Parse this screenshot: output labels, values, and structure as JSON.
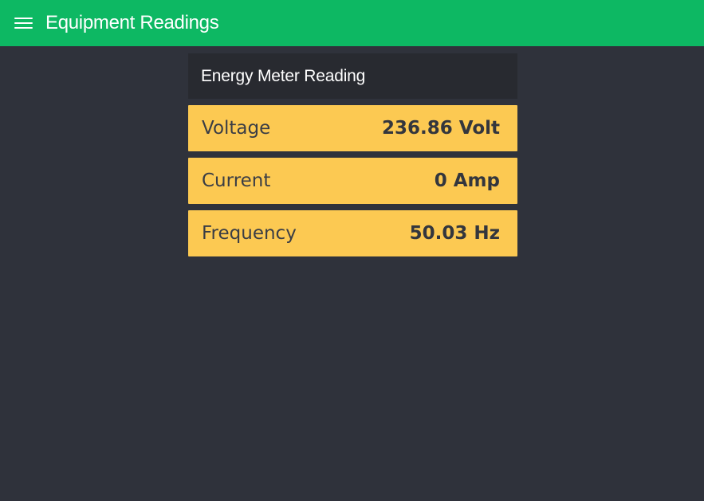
{
  "header": {
    "menu_icon": "hamburger-menu-icon",
    "title": "Equipment Readings"
  },
  "colors": {
    "header_bg": "#0db863",
    "page_bg": "#2f323b",
    "panel_header_bg": "#282a30",
    "reading_bg": "#fcc952"
  },
  "panel": {
    "title": "Energy Meter Reading",
    "readings": [
      {
        "label": "Voltage",
        "value": "236.86 Volt"
      },
      {
        "label": "Current",
        "value": "0 Amp"
      },
      {
        "label": "Frequency",
        "value": "50.03 Hz"
      }
    ]
  }
}
